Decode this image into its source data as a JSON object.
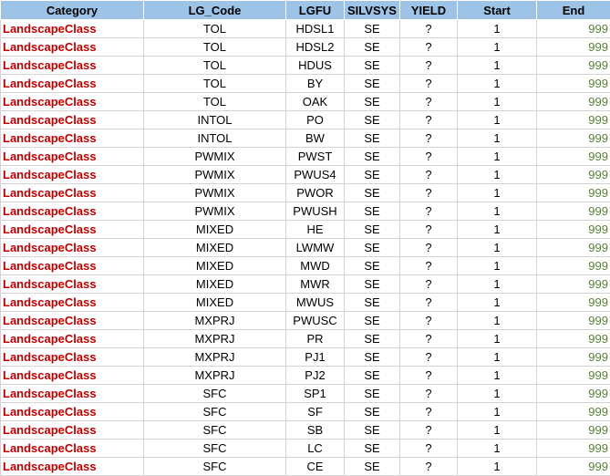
{
  "header": {
    "category": "Category",
    "lg_code": "LG_Code",
    "lgfu": "LGFU",
    "silvsys": "SILVSYS",
    "yield": "YIELD",
    "start": "Start",
    "end": "End"
  },
  "colors": {
    "header_bg": "#9dc3e6",
    "category_text": "#c00000",
    "end_text": "#548235"
  },
  "rows": [
    {
      "category": "LandscapeClass",
      "lg_code": "TOL",
      "lgfu": "HDSL1",
      "silvsys": "SE",
      "yield": "?",
      "start": "1",
      "end": "999"
    },
    {
      "category": "LandscapeClass",
      "lg_code": "TOL",
      "lgfu": "HDSL2",
      "silvsys": "SE",
      "yield": "?",
      "start": "1",
      "end": "999"
    },
    {
      "category": "LandscapeClass",
      "lg_code": "TOL",
      "lgfu": "HDUS",
      "silvsys": "SE",
      "yield": "?",
      "start": "1",
      "end": "999"
    },
    {
      "category": "LandscapeClass",
      "lg_code": "TOL",
      "lgfu": "BY",
      "silvsys": "SE",
      "yield": "?",
      "start": "1",
      "end": "999"
    },
    {
      "category": "LandscapeClass",
      "lg_code": "TOL",
      "lgfu": "OAK",
      "silvsys": "SE",
      "yield": "?",
      "start": "1",
      "end": "999"
    },
    {
      "category": "LandscapeClass",
      "lg_code": "INTOL",
      "lgfu": "PO",
      "silvsys": "SE",
      "yield": "?",
      "start": "1",
      "end": "999"
    },
    {
      "category": "LandscapeClass",
      "lg_code": "INTOL",
      "lgfu": "BW",
      "silvsys": "SE",
      "yield": "?",
      "start": "1",
      "end": "999"
    },
    {
      "category": "LandscapeClass",
      "lg_code": "PWMIX",
      "lgfu": "PWST",
      "silvsys": "SE",
      "yield": "?",
      "start": "1",
      "end": "999"
    },
    {
      "category": "LandscapeClass",
      "lg_code": "PWMIX",
      "lgfu": "PWUS4",
      "silvsys": "SE",
      "yield": "?",
      "start": "1",
      "end": "999"
    },
    {
      "category": "LandscapeClass",
      "lg_code": "PWMIX",
      "lgfu": "PWOR",
      "silvsys": "SE",
      "yield": "?",
      "start": "1",
      "end": "999"
    },
    {
      "category": "LandscapeClass",
      "lg_code": "PWMIX",
      "lgfu": "PWUSH",
      "silvsys": "SE",
      "yield": "?",
      "start": "1",
      "end": "999"
    },
    {
      "category": "LandscapeClass",
      "lg_code": "MIXED",
      "lgfu": "HE",
      "silvsys": "SE",
      "yield": "?",
      "start": "1",
      "end": "999"
    },
    {
      "category": "LandscapeClass",
      "lg_code": "MIXED",
      "lgfu": "LWMW",
      "silvsys": "SE",
      "yield": "?",
      "start": "1",
      "end": "999"
    },
    {
      "category": "LandscapeClass",
      "lg_code": "MIXED",
      "lgfu": "MWD",
      "silvsys": "SE",
      "yield": "?",
      "start": "1",
      "end": "999"
    },
    {
      "category": "LandscapeClass",
      "lg_code": "MIXED",
      "lgfu": "MWR",
      "silvsys": "SE",
      "yield": "?",
      "start": "1",
      "end": "999"
    },
    {
      "category": "LandscapeClass",
      "lg_code": "MIXED",
      "lgfu": "MWUS",
      "silvsys": "SE",
      "yield": "?",
      "start": "1",
      "end": "999"
    },
    {
      "category": "LandscapeClass",
      "lg_code": "MXPRJ",
      "lgfu": "PWUSC",
      "silvsys": "SE",
      "yield": "?",
      "start": "1",
      "end": "999"
    },
    {
      "category": "LandscapeClass",
      "lg_code": "MXPRJ",
      "lgfu": "PR",
      "silvsys": "SE",
      "yield": "?",
      "start": "1",
      "end": "999"
    },
    {
      "category": "LandscapeClass",
      "lg_code": "MXPRJ",
      "lgfu": "PJ1",
      "silvsys": "SE",
      "yield": "?",
      "start": "1",
      "end": "999"
    },
    {
      "category": "LandscapeClass",
      "lg_code": "MXPRJ",
      "lgfu": "PJ2",
      "silvsys": "SE",
      "yield": "?",
      "start": "1",
      "end": "999"
    },
    {
      "category": "LandscapeClass",
      "lg_code": "SFC",
      "lgfu": "SP1",
      "silvsys": "SE",
      "yield": "?",
      "start": "1",
      "end": "999"
    },
    {
      "category": "LandscapeClass",
      "lg_code": "SFC",
      "lgfu": "SF",
      "silvsys": "SE",
      "yield": "?",
      "start": "1",
      "end": "999"
    },
    {
      "category": "LandscapeClass",
      "lg_code": "SFC",
      "lgfu": "SB",
      "silvsys": "SE",
      "yield": "?",
      "start": "1",
      "end": "999"
    },
    {
      "category": "LandscapeClass",
      "lg_code": "SFC",
      "lgfu": "LC",
      "silvsys": "SE",
      "yield": "?",
      "start": "1",
      "end": "999"
    },
    {
      "category": "LandscapeClass",
      "lg_code": "SFC",
      "lgfu": "CE",
      "silvsys": "SE",
      "yield": "?",
      "start": "1",
      "end": "999"
    }
  ]
}
